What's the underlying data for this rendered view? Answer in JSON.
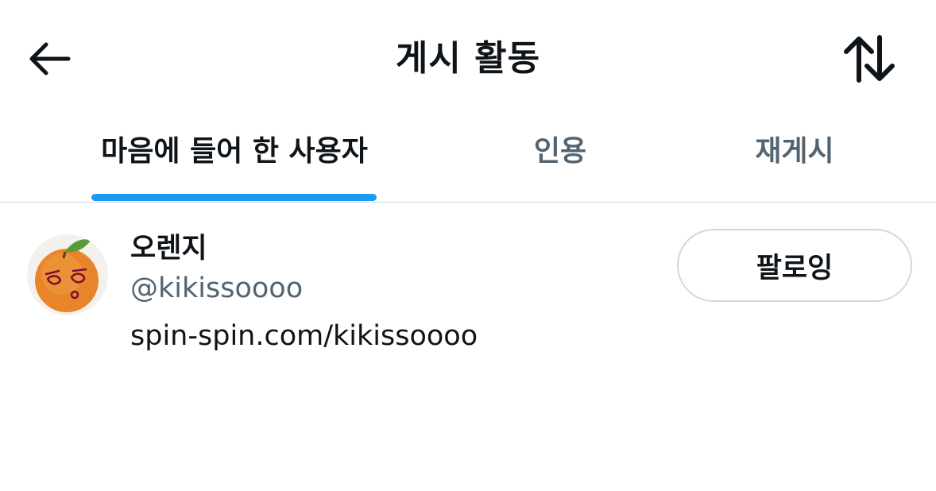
{
  "header": {
    "title": "게시 활동",
    "back_icon": "arrow-left-icon",
    "sort_icon": "sort-arrows-icon"
  },
  "tabs": [
    {
      "label": "마음에 들어 한 사용자",
      "active": true
    },
    {
      "label": "인용",
      "active": false
    },
    {
      "label": "재게시",
      "active": false
    }
  ],
  "users": [
    {
      "name": "오렌지",
      "handle": "@kikissoooo",
      "bio": "spin-spin.com/kikissoooo",
      "follow_label": "팔로잉"
    }
  ],
  "colors": {
    "accent": "#1d9bf0",
    "text_primary": "#0f1419",
    "text_secondary": "#536471",
    "border": "#cfd9de"
  }
}
